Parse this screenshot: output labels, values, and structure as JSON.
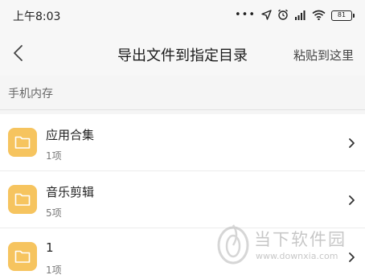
{
  "status_bar": {
    "time": "上午8:03",
    "battery": "81"
  },
  "nav": {
    "title": "导出文件到指定目录",
    "paste_label": "粘贴到这里"
  },
  "section": {
    "label": "手机内存"
  },
  "folders": [
    {
      "name": "应用合集",
      "count": "1项"
    },
    {
      "name": "音乐剪辑",
      "count": "5项"
    },
    {
      "name": "1",
      "count": "1项"
    }
  ],
  "watermark": {
    "name": "当下软件园",
    "url": "www.downxia.com"
  },
  "colors": {
    "folder": "#f6c45f",
    "background": "#f5f5f5",
    "card": "#ffffff"
  }
}
